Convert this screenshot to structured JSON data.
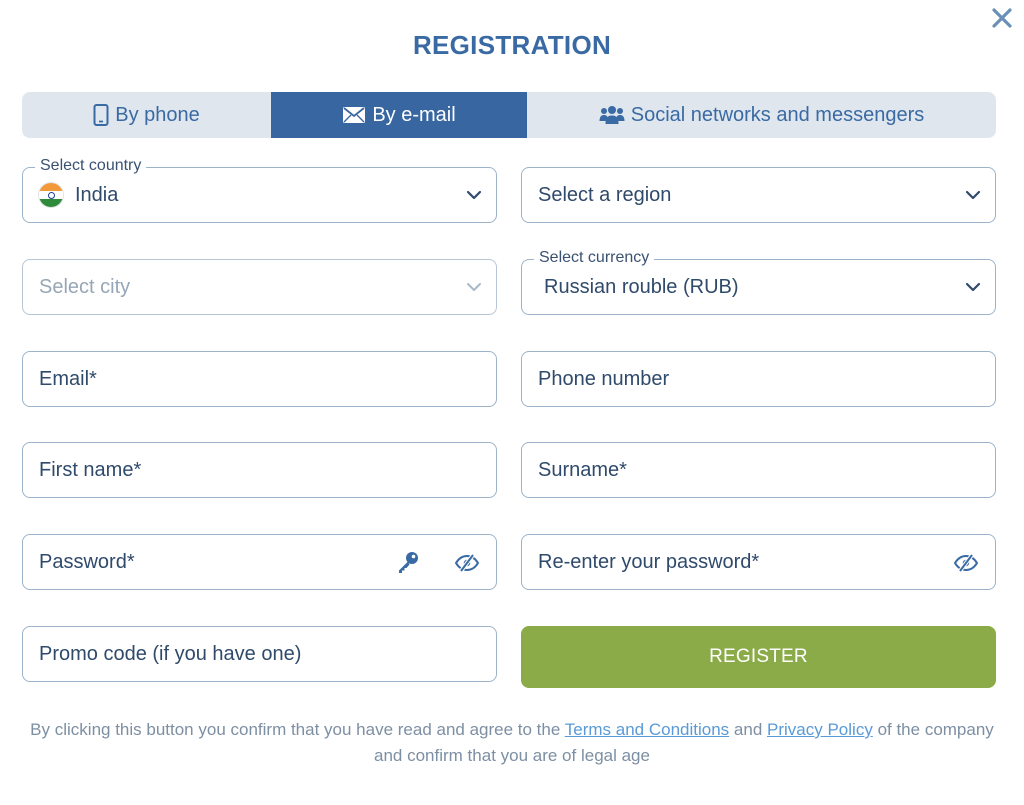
{
  "dialog": {
    "title": "REGISTRATION"
  },
  "tabs": [
    {
      "label": "By phone",
      "icon": "phone-icon",
      "active": false
    },
    {
      "label": "By e-mail",
      "icon": "envelope-icon",
      "active": true
    },
    {
      "label": "Social networks and messengers",
      "icon": "users-icon",
      "active": false
    }
  ],
  "form": {
    "country": {
      "legend": "Select country",
      "value": "India"
    },
    "region": {
      "placeholder": "Select a region"
    },
    "city": {
      "placeholder": "Select city"
    },
    "currency": {
      "legend": "Select currency",
      "value": "Russian rouble (RUB)"
    },
    "email": {
      "placeholder": "Email*"
    },
    "phone": {
      "placeholder": "Phone number"
    },
    "first_name": {
      "placeholder": "First name*"
    },
    "surname": {
      "placeholder": "Surname*"
    },
    "password": {
      "placeholder": "Password*"
    },
    "password_repeat": {
      "placeholder": "Re-enter your password*"
    },
    "promo": {
      "placeholder": "Promo code (if you have one)"
    },
    "register_label": "REGISTER"
  },
  "legal": {
    "prefix": "By clicking this button you confirm that you have read and agree to the",
    "terms_link": "Terms and Conditions",
    "and": "and",
    "privacy_link": "Privacy Policy",
    "suffix_line1": "of the company",
    "line2": "and confirm that you are of legal age"
  },
  "colors": {
    "accent": "#3866a0",
    "register": "#8bab48",
    "link": "#5a9ad6"
  }
}
